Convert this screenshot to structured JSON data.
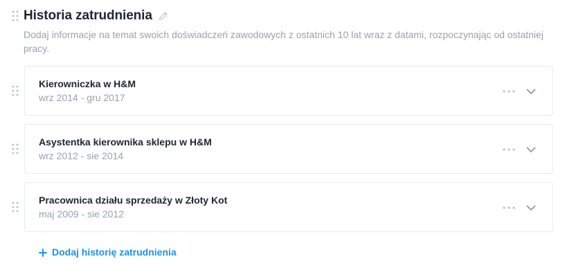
{
  "section": {
    "title": "Historia zatrudnienia",
    "description": "Dodaj informacje na temat swoich doświadczeń zawodowych z ostatnich 10 lat wraz z datami, rozpoczynając od ostatniej pracy."
  },
  "entries": [
    {
      "title": "Kierowniczka w H&M",
      "dates": "wrz 2014 - gru 2017"
    },
    {
      "title": "Asystentka kierownika sklepu w H&M",
      "dates": "wrz 2012 - sie 2014"
    },
    {
      "title": "Pracownica działu sprzedaży w Złoty Kot",
      "dates": "maj 2009 - sie 2012"
    }
  ],
  "add_button": {
    "label": "Dodaj historię zatrudnienia"
  },
  "icons": {
    "drag": "drag-handle-icon",
    "edit": "pencil-icon",
    "more": "more-options-icon",
    "expand": "chevron-down-icon",
    "add": "plus-icon"
  },
  "colors": {
    "title": "#1e2532",
    "muted": "#98a1b3",
    "accent": "#1a91f0",
    "border": "#e7eaf4",
    "icon": "#bec4d5"
  }
}
